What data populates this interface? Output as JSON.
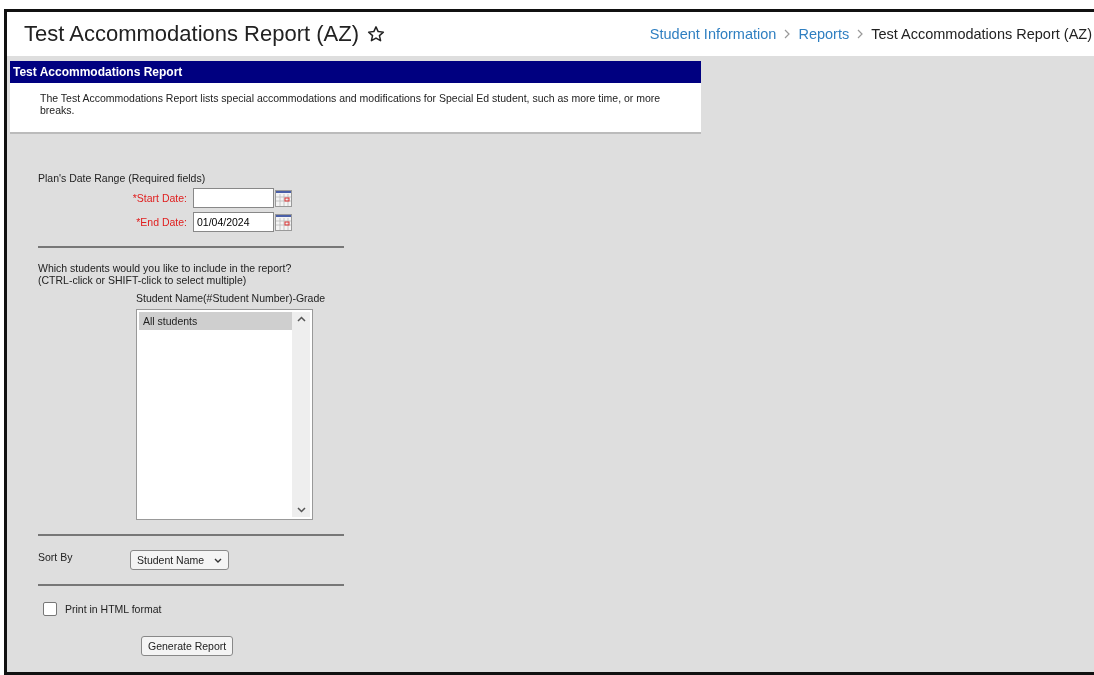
{
  "page_title": "Test Accommodations Report (AZ)",
  "breadcrumbs": [
    {
      "label": "Student Information",
      "current": false
    },
    {
      "label": "Reports",
      "current": false
    },
    {
      "label": "Test Accommodations Report (AZ)",
      "current": true
    }
  ],
  "panel": {
    "title": "Test Accommodations Report",
    "description": "The Test Accommodations Report lists special accommodations and modifications for Special Ed student, such as more time, or more breaks."
  },
  "date_range": {
    "heading": "Plan's Date Range (Required fields)",
    "fields": [
      {
        "label": "*Start Date:",
        "required": true
      },
      {
        "label": "*End Date:",
        "required": true,
        "value": "01/04/2024"
      }
    ]
  },
  "students": {
    "question": "Which students would you like to include in the report?",
    "hint": "(CTRL-click or SHIFT-click to select multiple)",
    "list_label": "Student Name(#Student Number)-Grade",
    "options": [
      {
        "label": "All students",
        "selected": true
      }
    ]
  },
  "sort": {
    "label": "Sort By",
    "value": "Student Name"
  },
  "print_html": {
    "label": "Print in HTML format",
    "checked": false
  },
  "button": "Generate Report"
}
